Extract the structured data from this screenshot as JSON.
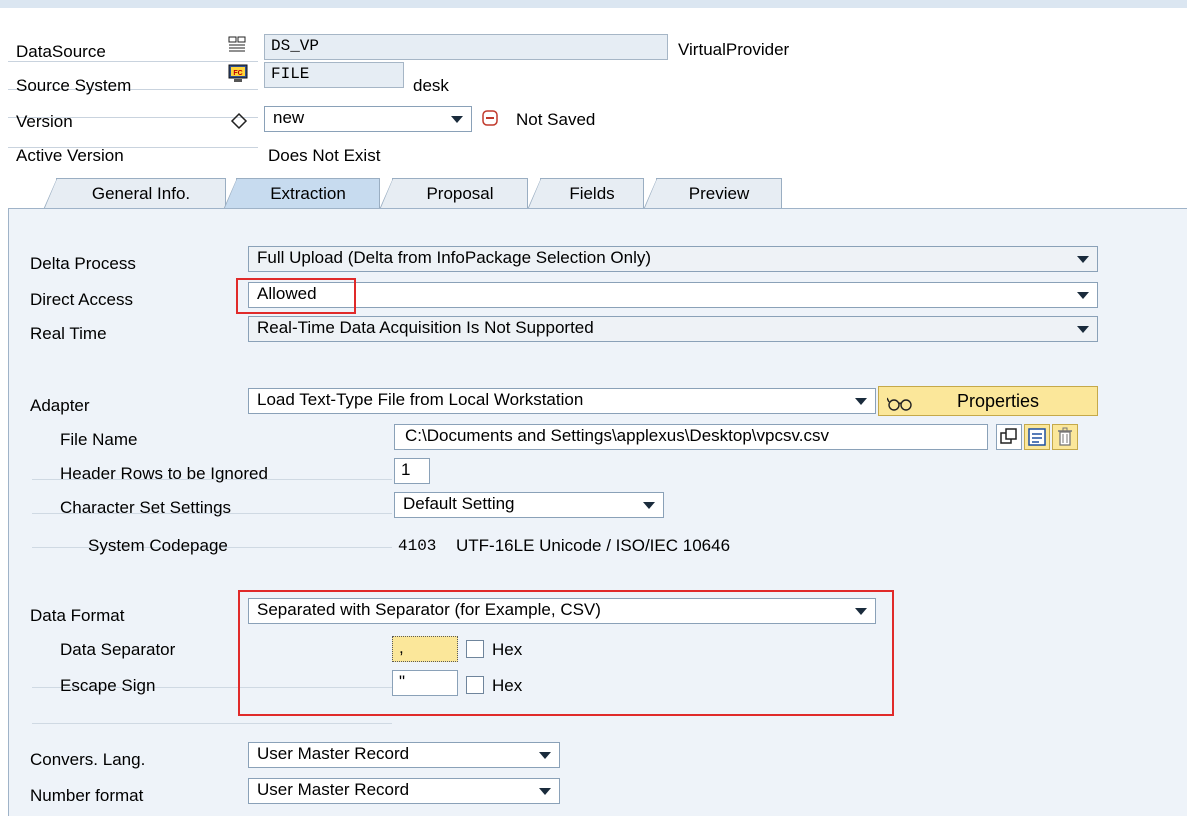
{
  "header": {
    "datasource": {
      "label": "DataSource",
      "value": "DS_VP",
      "description": "VirtualProvider"
    },
    "source_system": {
      "label": "Source System",
      "value": "FILE",
      "description": "desk"
    },
    "version": {
      "label": "Version",
      "value": "new",
      "status": "Not Saved"
    },
    "active_version": {
      "label": "Active Version",
      "value": "Does Not Exist"
    }
  },
  "tabs": [
    {
      "label": "General Info.",
      "active": false
    },
    {
      "label": "Extraction",
      "active": true
    },
    {
      "label": "Proposal",
      "active": false
    },
    {
      "label": "Fields",
      "active": false
    },
    {
      "label": "Preview",
      "active": false
    }
  ],
  "extraction": {
    "delta_process": {
      "label": "Delta Process",
      "value": "Full Upload (Delta from InfoPackage Selection Only)"
    },
    "direct_access": {
      "label": "Direct Access",
      "value": "Allowed"
    },
    "real_time": {
      "label": "Real Time",
      "value": "Real-Time Data Acquisition Is Not Supported"
    },
    "adapter": {
      "label": "Adapter",
      "value": "Load Text-Type File from Local Workstation",
      "properties_button": "Properties"
    },
    "file_name": {
      "label": "File Name",
      "value": "C:\\Documents and Settings\\applexus\\Desktop\\vpcsv.csv"
    },
    "header_rows": {
      "label": "Header Rows to be Ignored",
      "value": "1"
    },
    "charset": {
      "label": "Character Set Settings",
      "value": "Default Setting"
    },
    "codepage": {
      "label": "System Codepage",
      "code": "4103",
      "description": "UTF-16LE Unicode / ISO/IEC 10646"
    },
    "data_format": {
      "label": "Data Format",
      "value": "Separated with Separator (for Example, CSV)"
    },
    "data_separator": {
      "label": "Data Separator",
      "value": ",",
      "hex_label": "Hex"
    },
    "escape_sign": {
      "label": "Escape Sign",
      "value": "\"",
      "hex_label": "Hex"
    },
    "convers_lang": {
      "label": "Convers. Lang.",
      "value": "User Master Record"
    },
    "number_format": {
      "label": "Number format",
      "value": "User Master Record"
    }
  },
  "colors": {
    "highlight": "#e02a2a",
    "active_tab": "#c7dbef",
    "panel": "#eef3f9",
    "yellow_button": "#fbe79a"
  }
}
